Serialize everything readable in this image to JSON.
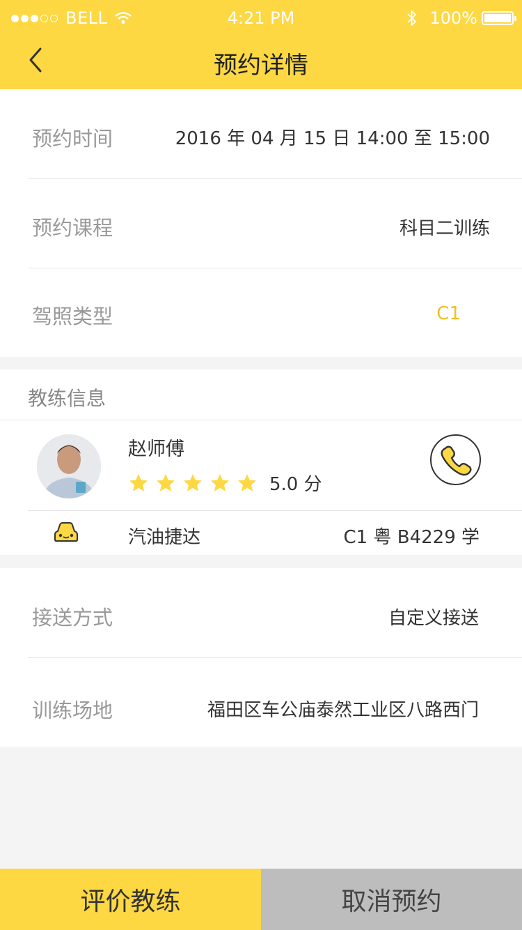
{
  "status_bar": {
    "carrier": "BELL",
    "time": "4:21 PM",
    "battery": "100%"
  },
  "nav": {
    "title": "预约详情"
  },
  "booking": {
    "time_label": "预约时间",
    "time_value": "2016 年 04 月 15 日  14:00 至 15:00",
    "course_label": "预约课程",
    "course_value": "科目二训练",
    "license_label": "驾照类型",
    "license_value": "C1"
  },
  "coach": {
    "section_title": "教练信息",
    "name": "赵师傅",
    "rating": 5,
    "score_text": "5.0 分",
    "car_name": "汽油捷达",
    "car_plate": "C1 粤 B4229 学"
  },
  "pickup": {
    "method_label": "接送方式",
    "method_value": "自定义接送",
    "venue_label": "训练场地",
    "venue_value": "福田区车公庙泰然工业区八路西门"
  },
  "actions": {
    "rate_label": "评价教练",
    "cancel_label": "取消预约"
  },
  "colors": {
    "accent": "#fdd843",
    "license_highlight": "#f2bf22",
    "cancel_bg": "#bdbdbd"
  }
}
